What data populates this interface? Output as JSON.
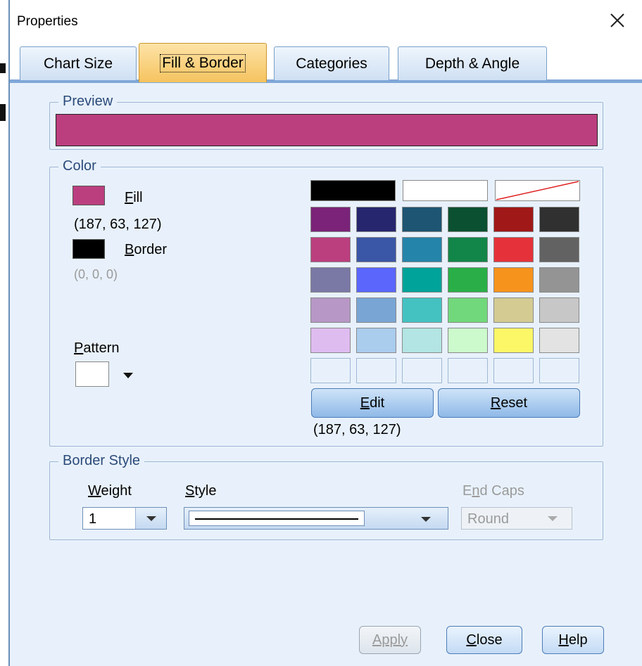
{
  "window": {
    "title": "Properties"
  },
  "tabs": [
    {
      "label": "Chart Size",
      "active": false
    },
    {
      "label": "Fill & Border",
      "active": true
    },
    {
      "label": "Categories",
      "active": false
    },
    {
      "label": "Depth & Angle",
      "active": false
    }
  ],
  "preview": {
    "label": "Preview",
    "color": "#bb3f7f"
  },
  "color_group": {
    "label": "Color",
    "fill": {
      "label_first": "F",
      "label_rest": "ill",
      "color": "#bb3f7f",
      "rgb_text": "(187, 63, 127)"
    },
    "border": {
      "label_first": "B",
      "label_rest": "order",
      "color": "#000000",
      "rgb_text": "(0, 0, 0)"
    },
    "pattern": {
      "label_first": "P",
      "label_rest": "attern"
    },
    "palette_top": [
      "#000000",
      "#ffffff",
      "transparent"
    ],
    "palette": [
      [
        "#7a2378",
        "#26266e",
        "#1d5572",
        "#0b5030",
        "#a01818",
        "#303030"
      ],
      [
        "#bb3f7f",
        "#3a56a6",
        "#2484aa",
        "#128648",
        "#e5323a",
        "#626262"
      ],
      [
        "#7a79a6",
        "#5a66fc",
        "#00a39a",
        "#2aaf48",
        "#f6931d",
        "#949494"
      ],
      [
        "#b797c5",
        "#79a5d5",
        "#44c2c2",
        "#72d87c",
        "#d3cb92",
        "#c7c7c7"
      ],
      [
        "#dfbcf0",
        "#aacced",
        "#b2e5e3",
        "#ccfacc",
        "#fcf767",
        "#e3e3e3"
      ],
      [
        "#e8f1fb",
        "#e8f1fb",
        "#e8f1fb",
        "#e8f1fb",
        "#e8f1fb",
        "#e8f1fb"
      ]
    ],
    "edit_first": "E",
    "edit_rest": "dit",
    "reset_first": "R",
    "reset_rest": "eset",
    "selected_rgb_text": "(187, 63, 127)"
  },
  "border_style": {
    "label": "Border Style",
    "weight": {
      "label_first": "W",
      "label_rest": "eight",
      "value": "1"
    },
    "style": {
      "label_first": "S",
      "label_rest": "tyle"
    },
    "end_caps": {
      "label_pre": "E",
      "label_u": "n",
      "label_rest": "d Caps",
      "value": "Round"
    }
  },
  "buttons": {
    "apply": "Apply",
    "close_first": "C",
    "close_rest": "lose",
    "help_first": "H",
    "help_rest": "elp"
  }
}
